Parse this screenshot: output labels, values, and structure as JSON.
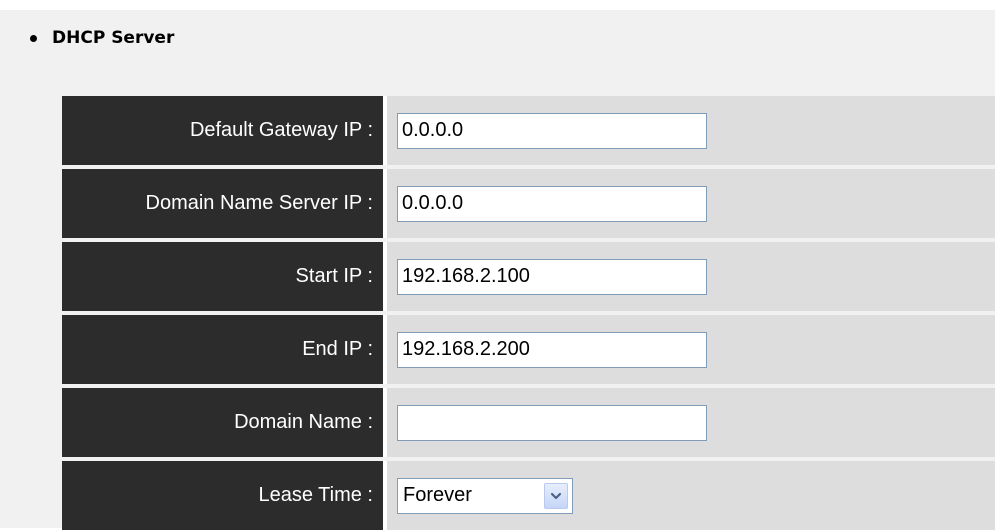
{
  "section": {
    "title": "DHCP Server"
  },
  "fields": [
    {
      "label": "Default Gateway IP :",
      "value": "0.0.0.0"
    },
    {
      "label": "Domain Name Server IP :",
      "value": "0.0.0.0"
    },
    {
      "label": "Start IP :",
      "value": "192.168.2.100"
    },
    {
      "label": "End IP :",
      "value": "192.168.2.200"
    },
    {
      "label": "Domain Name :",
      "value": ""
    }
  ],
  "lease": {
    "label": "Lease Time :",
    "selected": "Forever",
    "icon": "chevron-down-icon"
  },
  "colors": {
    "label_bg": "#2c2c2c",
    "value_bg": "#dddddd",
    "panel_bg": "#f1f1f1",
    "input_border": "#7f9db9"
  }
}
